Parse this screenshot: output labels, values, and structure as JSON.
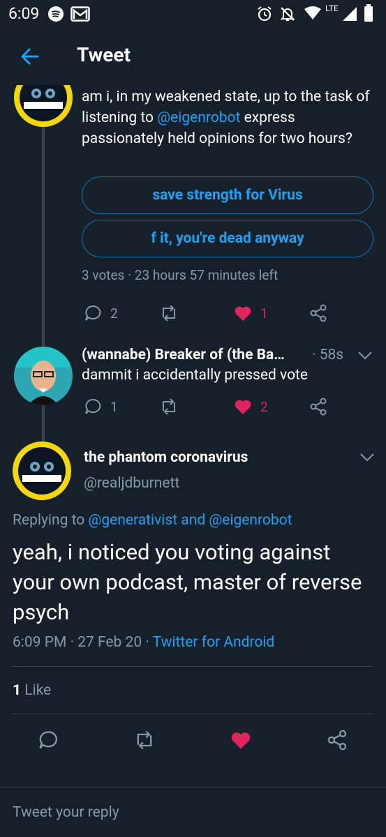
{
  "status_bar": {
    "time": "6:09",
    "network": "LTE",
    "icons": [
      "spotify-icon",
      "gmail-icon",
      "alarm-icon",
      "mute-icon",
      "wifi-icon",
      "signal-icon",
      "battery-icon"
    ]
  },
  "header": {
    "title": "Tweet",
    "back_icon": "arrow-left-icon"
  },
  "poll_tweet": {
    "text_before": "am i, in my weakened state, up to the task of listening to ",
    "mention": "@eigenrobot",
    "text_after": " express passionately held opinions for two hours?",
    "options": [
      "save strength for Virus",
      "f it, you're dead anyway"
    ],
    "summary": "3 votes · 23 hours 57 minutes left",
    "actions": {
      "replies": "2",
      "likes": "1"
    }
  },
  "reply_tweet": {
    "author": "(wannabe) Breaker of (the Ba…",
    "time": "· 58s",
    "text": "dammit i accidentally pressed vote",
    "actions": {
      "replies": "1",
      "likes": "2"
    }
  },
  "main_tweet": {
    "author": "the phantom coronavirus",
    "handle": "@realjdburnett",
    "replying_prefix": "Replying to ",
    "replying_to_1": "@generativist",
    "replying_and": " and ",
    "replying_to_2": "@eigenrobot",
    "text": "yeah, i noticed you voting against your own podcast, master of reverse psych",
    "timestamp": "6:09 PM · 27 Feb 20 · ",
    "source": "Twitter for Android",
    "likes_count": "1",
    "likes_label": " Like"
  },
  "reply_input": {
    "placeholder": "Tweet your reply"
  },
  "colors": {
    "background": "#15202b",
    "accent": "#1da1f2",
    "like": "#e0245e",
    "muted": "#8899a6",
    "divider": "#38444d"
  }
}
